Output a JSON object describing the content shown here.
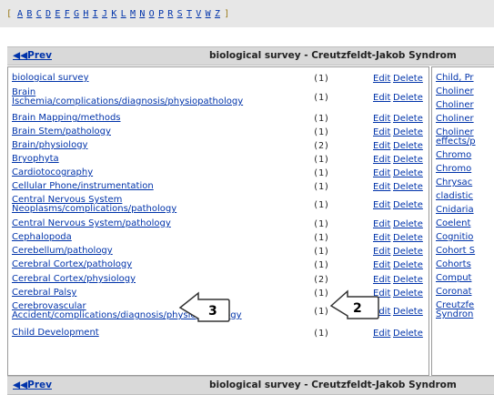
{
  "alphabet": [
    "A",
    "B",
    "C",
    "D",
    "E",
    "F",
    "G",
    "H",
    "I",
    "J",
    "K",
    "L",
    "M",
    "N",
    "O",
    "P",
    "R",
    "S",
    "T",
    "V",
    "W",
    "Z"
  ],
  "header": {
    "prev_label": "Prev",
    "title": "biological survey - Creutzfeldt-Jakob Syndrom"
  },
  "edit_label": "Edit",
  "delete_label": "Delete",
  "left_rows": [
    {
      "lines": [
        "biological survey"
      ],
      "count": "(1)"
    },
    {
      "lines": [
        "Brain",
        "Ischemia/complications/diagnosis/physiopathology"
      ],
      "count": "(1)"
    },
    {
      "lines": [
        "Brain Mapping/methods"
      ],
      "count": "(1)"
    },
    {
      "lines": [
        "Brain Stem/pathology"
      ],
      "count": "(1)"
    },
    {
      "lines": [
        "Brain/physiology"
      ],
      "count": "(2)"
    },
    {
      "lines": [
        "Bryophyta"
      ],
      "count": "(1)"
    },
    {
      "lines": [
        "Cardiotocography"
      ],
      "count": "(1)"
    },
    {
      "lines": [
        "Cellular Phone/instrumentation"
      ],
      "count": "(1)"
    },
    {
      "lines": [
        "Central Nervous System",
        "Neoplasms/complications/pathology"
      ],
      "count": "(1)"
    },
    {
      "lines": [
        "Central Nervous System/pathology"
      ],
      "count": "(1)"
    },
    {
      "lines": [
        "Cephalopoda"
      ],
      "count": "(1)"
    },
    {
      "lines": [
        "Cerebellum/pathology"
      ],
      "count": "(1)"
    },
    {
      "lines": [
        "Cerebral Cortex/pathology"
      ],
      "count": "(1)"
    },
    {
      "lines": [
        "Cerebral Cortex/physiology"
      ],
      "count": "(2)"
    },
    {
      "lines": [
        "Cerebral Palsy"
      ],
      "count": "(1)"
    },
    {
      "lines": [
        "Cerebrovascular",
        "Accident/complications/diagnosis/physiopathology"
      ],
      "count": "(1)"
    },
    {
      "lines": [
        "Child Development"
      ],
      "count": "(1)"
    }
  ],
  "right_rows": [
    "Child, Pr",
    "Choliner",
    "Choliner",
    "Choliner",
    "Choliner",
    "effects/p",
    "Chromo",
    "Chromo",
    "Chrysac",
    "cladistic",
    "Cnidaria",
    "Coelent",
    "Cognitio",
    "Cohort S",
    "Cohorts",
    "Comput",
    "Coronat",
    "Creutzfe",
    "Syndron"
  ],
  "callouts": [
    "3",
    "2"
  ]
}
